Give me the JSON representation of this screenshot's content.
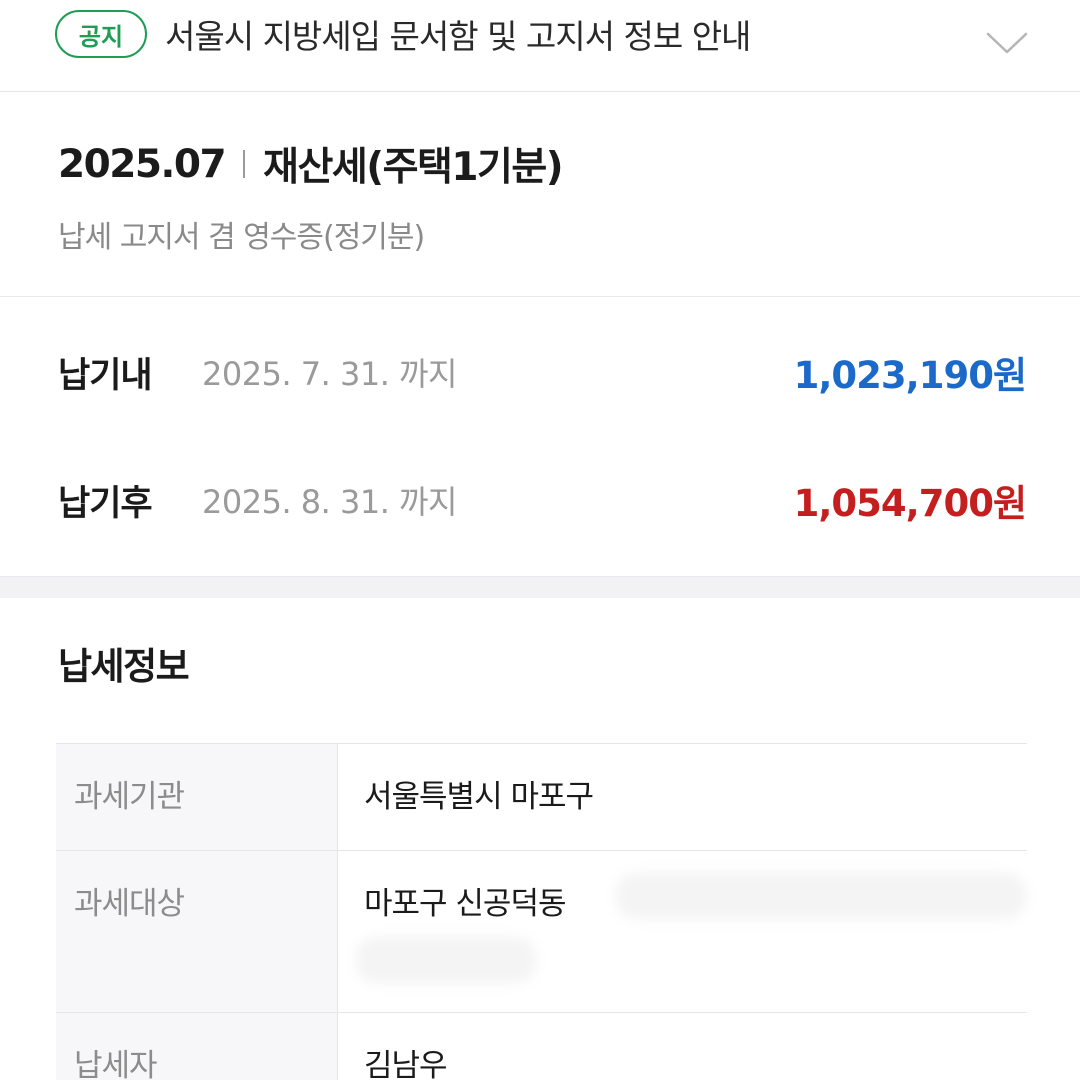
{
  "notice": {
    "badge": "공지",
    "title": "서울시 지방세입 문서함 및 고지서 정보 안내"
  },
  "bill": {
    "period": "2025.07",
    "tax_name": "재산세(주택1기분)",
    "subtitle": "납세 고지서 겸 영수증(정기분)"
  },
  "payments": [
    {
      "label": "납기내",
      "due": "2025. 7. 31. 까지",
      "amount": "1,023,190원"
    },
    {
      "label": "납기후",
      "due": "2025. 8. 31. 까지",
      "amount": "1,054,700원"
    }
  ],
  "info": {
    "heading": "납세정보",
    "rows": [
      {
        "key": "과세기관",
        "value": "서울특별시 마포구"
      },
      {
        "key": "과세대상",
        "value": "마포구 신공덕동"
      },
      {
        "key": "납세자",
        "value": "김남우"
      }
    ]
  },
  "colors": {
    "accent_green": "#1f9d55",
    "amount_before_due": "#1b6ac9",
    "amount_after_due": "#c41e1e"
  },
  "icons": {
    "expand": "chevron-down-icon"
  }
}
